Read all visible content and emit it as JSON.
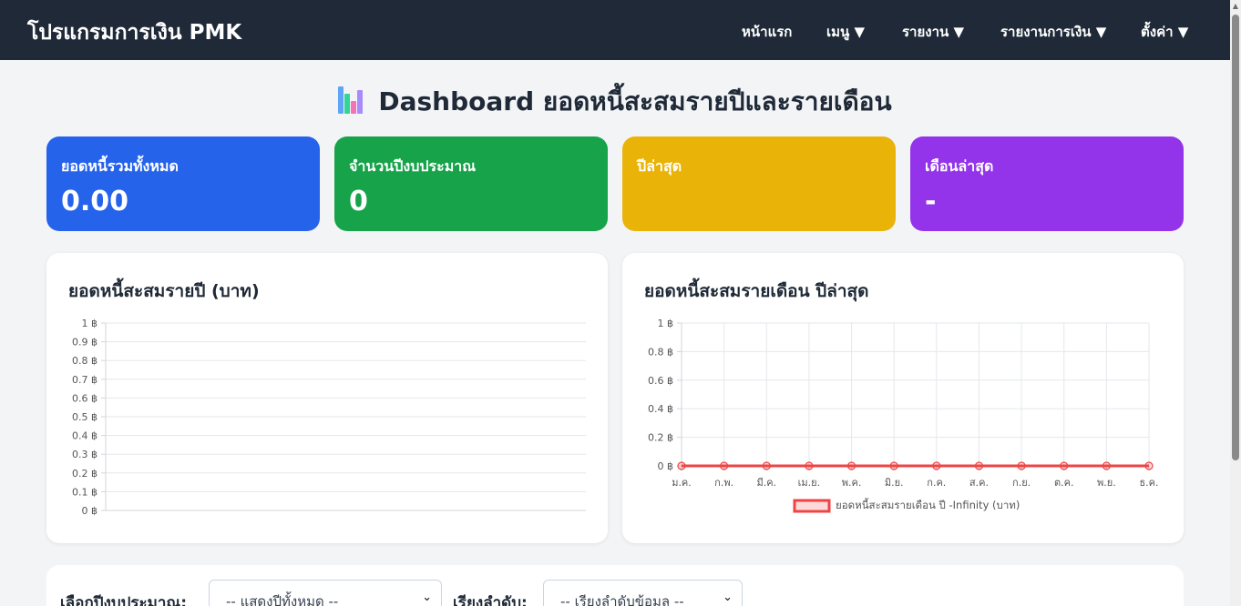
{
  "nav": {
    "brand": "โปรแกรมการเงิน PMK",
    "items": [
      {
        "label": "หน้าแรก"
      },
      {
        "label": "เมนู ▼"
      },
      {
        "label": "รายงาน ▼"
      },
      {
        "label": "รายงานการเงิน ▼"
      },
      {
        "label": "ตั้งค่า ▼"
      }
    ]
  },
  "page": {
    "title": "Dashboard ยอดหนี้สะสมรายปีและรายเดือน",
    "title_icon": "bar-chart-emoji-icon"
  },
  "cards": [
    {
      "label": "ยอดหนี้รวมทั้งหมด",
      "value": "0.00",
      "color": "#2563eb"
    },
    {
      "label": "จำนวนปีงบประมาณ",
      "value": "0",
      "color": "#16a34a"
    },
    {
      "label": "ปีล่าสุด",
      "value": "",
      "color": "#eab308"
    },
    {
      "label": "เดือนล่าสุด",
      "value": "-",
      "color": "#9333ea"
    }
  ],
  "chart_data": [
    {
      "type": "bar",
      "title": "ยอดหนี้สะสมรายปี (บาท)",
      "categories": [],
      "values": [],
      "ylim": [
        0,
        1
      ],
      "yticks": [
        "1 ฿",
        "0.9 ฿",
        "0.8 ฿",
        "0.7 ฿",
        "0.6 ฿",
        "0.5 ฿",
        "0.4 ฿",
        "0.3 ฿",
        "0.2 ฿",
        "0.1 ฿",
        "0 ฿"
      ],
      "grid": true
    },
    {
      "type": "line",
      "title": "ยอดหนี้สะสมรายเดือน ปีล่าสุด",
      "categories": [
        "ม.ค.",
        "ก.พ.",
        "มี.ค.",
        "เม.ย.",
        "พ.ค.",
        "มิ.ย.",
        "ก.ค.",
        "ส.ค.",
        "ก.ย.",
        "ต.ค.",
        "พ.ย.",
        "ธ.ค."
      ],
      "series": [
        {
          "name": "ยอดหนี้สะสมรายเดือน ปี -Infinity (บาท)",
          "values": [
            0,
            0,
            0,
            0,
            0,
            0,
            0,
            0,
            0,
            0,
            0,
            0
          ],
          "color": "#ef4444"
        }
      ],
      "ylim": [
        0,
        1
      ],
      "yticks": [
        "1 ฿",
        "0.8 ฿",
        "0.6 ฿",
        "0.4 ฿",
        "0.2 ฿",
        "0 ฿"
      ],
      "grid": true,
      "legend": "bottom"
    }
  ],
  "filters": {
    "year_label": "เลือกปีงบประมาณ:",
    "year_value": "-- แสดงปีทั้งหมด --",
    "sort_label": "เรียงลำดับ:",
    "sort_value": "-- เรียงลำดับข้อมูล --"
  }
}
